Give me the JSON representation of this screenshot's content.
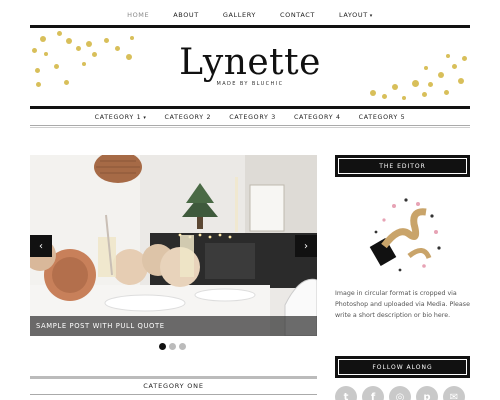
{
  "topnav": {
    "items": [
      {
        "label": "HOME"
      },
      {
        "label": "ABOUT"
      },
      {
        "label": "GALLERY"
      },
      {
        "label": "CONTACT"
      },
      {
        "label": "LAYOUT"
      }
    ]
  },
  "header": {
    "title": "Lynette",
    "subtitle": "MADE BY BLUCHIC"
  },
  "categories": [
    {
      "label": "CATEGORY 1"
    },
    {
      "label": "CATEGORY 2"
    },
    {
      "label": "CATEGORY 3"
    },
    {
      "label": "CATEGORY 4"
    },
    {
      "label": "CATEGORY 5"
    }
  ],
  "slider": {
    "caption": "SAMPLE POST WITH PULL QUOTE",
    "prev_icon": "chevron-left-icon",
    "next_icon": "chevron-right-icon",
    "slide_count": 3,
    "active_slide": 1
  },
  "section": {
    "title": "CATEGORY ONE"
  },
  "sidebar": {
    "editor_title": "THE EDITOR",
    "editor_text": "Image in circular format is cropped via Photoshop and uploaded via Media. Please write a short description or bio here.",
    "follow_title": "FOLLOW ALONG",
    "social": [
      {
        "icon": "twitter-icon",
        "glyph": "t"
      },
      {
        "icon": "facebook-icon",
        "glyph": "f"
      },
      {
        "icon": "instagram-icon",
        "glyph": "◎"
      },
      {
        "icon": "pinterest-icon",
        "glyph": "p"
      },
      {
        "icon": "email-icon",
        "glyph": "✉"
      }
    ]
  },
  "colors": {
    "accent_gold": "#d8bf5a",
    "dark": "#111111"
  }
}
